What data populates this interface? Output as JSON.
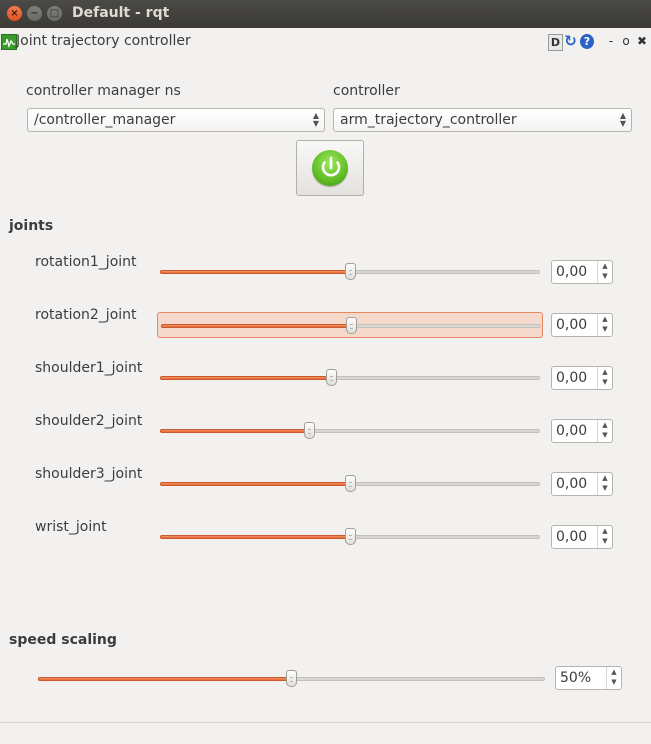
{
  "window": {
    "title": "Default - rqt",
    "close_glyph": "×",
    "min_glyph": "−",
    "max_glyph": "□"
  },
  "plugin": {
    "title": "Joint trajectory controller",
    "icons": {
      "d_button": "D",
      "reload": "↻",
      "help": "?",
      "minimize": "-",
      "float": "o",
      "close": "✖"
    }
  },
  "controller_manager": {
    "label": "controller manager ns",
    "selected": "/controller_manager"
  },
  "controller": {
    "label": "controller",
    "selected": "arm_trajectory_controller"
  },
  "power_button": {
    "state": "on",
    "color": "#5cbf1f"
  },
  "joints": {
    "title": "joints",
    "items": [
      {
        "name": "rotation1_joint",
        "value": "0,00",
        "position": 0.5
      },
      {
        "name": "rotation2_joint",
        "value": "0,00",
        "position": 0.5
      },
      {
        "name": "shoulder1_joint",
        "value": "0,00",
        "position": 0.45
      },
      {
        "name": "shoulder2_joint",
        "value": "0,00",
        "position": 0.39
      },
      {
        "name": "shoulder3_joint",
        "value": "0,00",
        "position": 0.5
      },
      {
        "name": "wrist_joint",
        "value": "0,00",
        "position": 0.5
      }
    ]
  },
  "speed_scaling": {
    "title": "speed scaling",
    "value": "50%",
    "position": 0.5
  },
  "colors": {
    "accent": "#e9672f",
    "titlebar": "#3c3b37"
  }
}
